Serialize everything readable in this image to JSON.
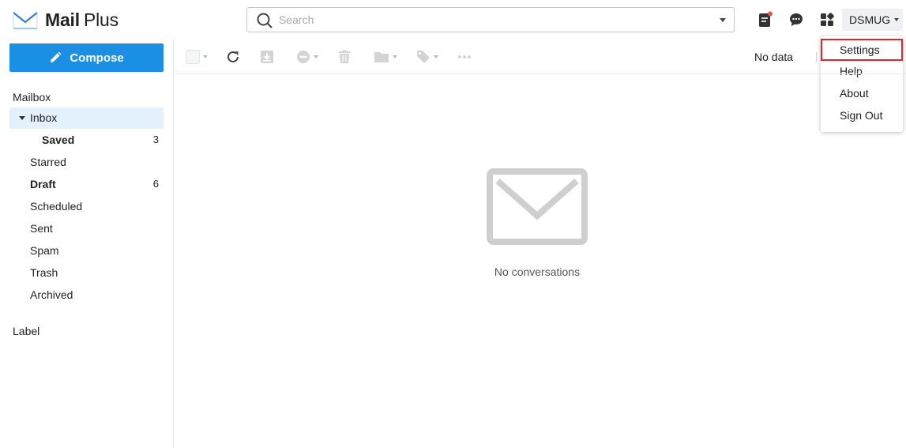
{
  "app": {
    "name_bold": "Mail",
    "name_light": "Plus"
  },
  "search": {
    "placeholder": "Search",
    "value": ""
  },
  "header": {
    "user_name": "DSMUG"
  },
  "user_menu": {
    "items": [
      "Settings",
      "Help",
      "About",
      "Sign Out"
    ]
  },
  "sidebar": {
    "compose_label": "Compose",
    "mailbox_label": "Mailbox",
    "folders": [
      {
        "label": "Inbox",
        "count": ""
      },
      {
        "label": "Saved",
        "count": "3"
      },
      {
        "label": "Starred",
        "count": ""
      },
      {
        "label": "Draft",
        "count": "6"
      },
      {
        "label": "Scheduled",
        "count": ""
      },
      {
        "label": "Sent",
        "count": ""
      },
      {
        "label": "Spam",
        "count": ""
      },
      {
        "label": "Trash",
        "count": ""
      },
      {
        "label": "Archived",
        "count": ""
      }
    ],
    "label_section": "Label"
  },
  "toolbar": {
    "status_text": "No data"
  },
  "main": {
    "empty_text": "No conversations"
  },
  "colors": {
    "accent": "#1a8fe3",
    "highlight_border": "#e0262b",
    "active_bg": "#e3f1fc",
    "notify_dot": "#e8543a"
  },
  "icons": [
    "mail-logo-icon",
    "search-icon",
    "notes-icon",
    "chat-icon",
    "apps-icon",
    "pencil-icon",
    "checkbox-icon",
    "refresh-icon",
    "archive-icon",
    "block-icon",
    "delete-icon",
    "move-folder-icon",
    "tag-icon",
    "more-icon",
    "envelope-icon"
  ]
}
